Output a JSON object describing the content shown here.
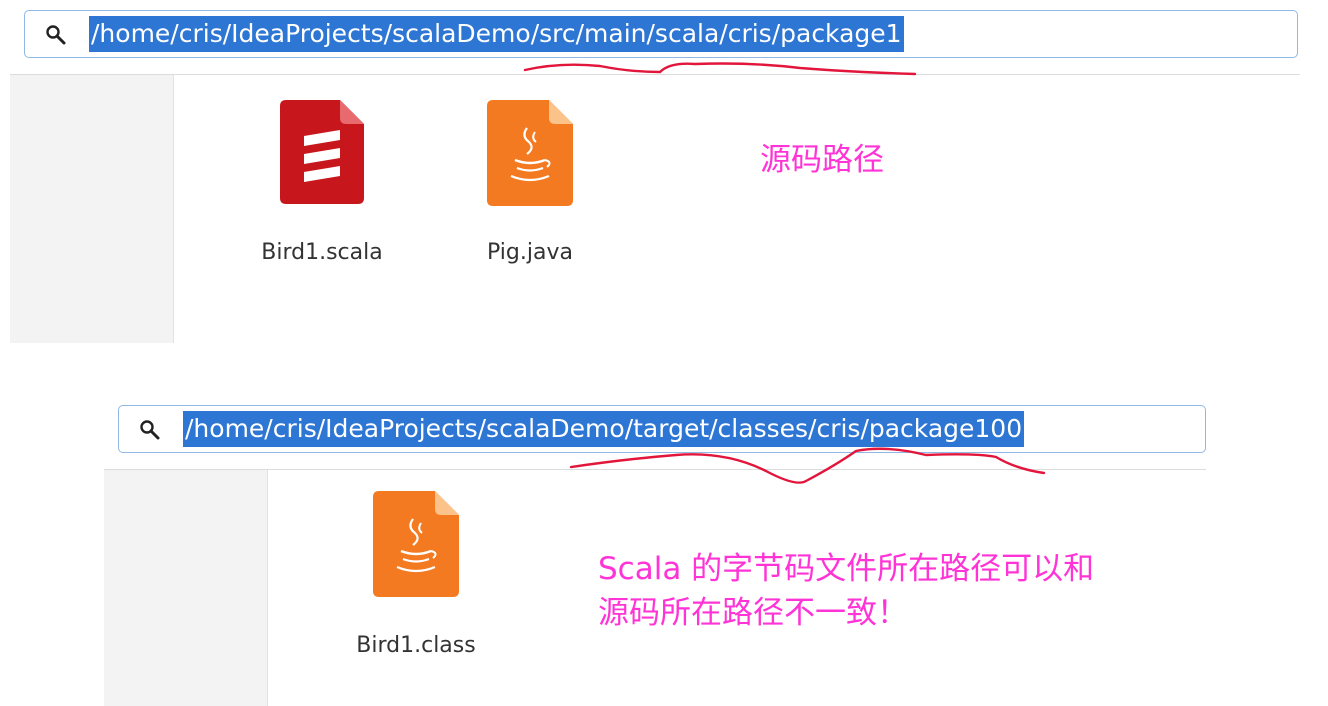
{
  "panel1": {
    "path": "/home/cris/IdeaProjects/scalaDemo/src/main/scala/cris/package1",
    "files": [
      {
        "name": "Bird1.scala",
        "icon": "scala-file-icon"
      },
      {
        "name": "Pig.java",
        "icon": "java-file-icon"
      }
    ],
    "note": "源码路径"
  },
  "panel2": {
    "path": "/home/cris/IdeaProjects/scalaDemo/target/classes/cris/package100",
    "files": [
      {
        "name": "Bird1.class",
        "icon": "java-file-icon"
      }
    ],
    "note_lines": [
      "Scala 的字节码文件所在路径可以和",
      "源码所在路径不一致！"
    ]
  },
  "colors": {
    "annotation": "#ff33d6",
    "selection": "#2d76d4",
    "scala_icon": "#c8161d",
    "java_icon": "#f47a21"
  }
}
